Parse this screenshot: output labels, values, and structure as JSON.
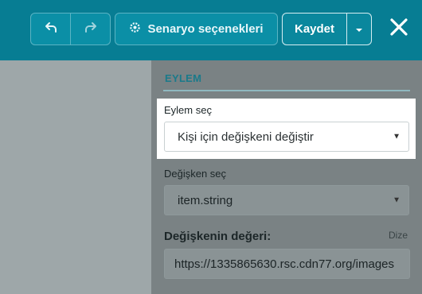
{
  "toolbar": {
    "undo_icon": "undo-icon",
    "redo_icon": "redo-icon",
    "scenario_label": "Senaryo seçenekleri",
    "scenario_icon": "gear-icon",
    "save_label": "Kaydet",
    "save_dropdown_icon": "caret-down-icon",
    "close_icon": "close-icon"
  },
  "panel": {
    "section_title": "EYLEM",
    "action_select": {
      "label": "Eylem seç",
      "value": "Kişi için değişkeni değiştir"
    },
    "variable_select": {
      "label": "Değişken seç",
      "value": "item.string"
    },
    "variable_value": {
      "label": "Değişkenin değeri:",
      "type": "Dize",
      "value": "https://1335865630.rsc.cdn77.org/images"
    }
  },
  "colors": {
    "topbar": "#077d93",
    "accent_text": "#1b7a8a",
    "overlay": "#7a8284"
  }
}
